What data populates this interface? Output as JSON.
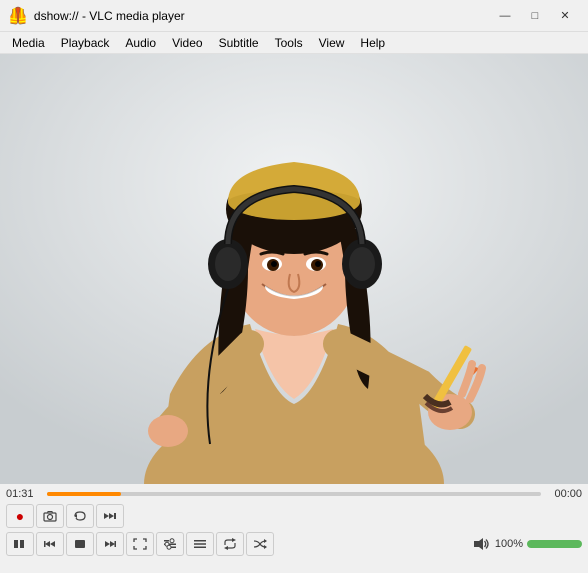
{
  "titleBar": {
    "title": "dshow:// - VLC media player",
    "iconColor": "#ff8800",
    "minBtn": "—",
    "maxBtn": "□",
    "closeBtn": "✕"
  },
  "menuBar": {
    "items": [
      "Media",
      "Playback",
      "Audio",
      "Video",
      "Subtitle",
      "Tools",
      "View",
      "Help"
    ]
  },
  "timeline": {
    "elapsed": "01:31",
    "remaining": "00:00",
    "progressPercent": 15
  },
  "controls": {
    "row1": [
      {
        "id": "record",
        "label": "●",
        "type": "red"
      },
      {
        "id": "snapshot",
        "label": "📷"
      },
      {
        "id": "loop",
        "label": "↻"
      },
      {
        "id": "play-next",
        "label": "▶|"
      }
    ],
    "row2": [
      {
        "id": "play-pause",
        "label": "⏸"
      },
      {
        "id": "prev",
        "label": "⏮"
      },
      {
        "id": "stop",
        "label": "■"
      },
      {
        "id": "next",
        "label": "⏭"
      },
      {
        "id": "fullscreen",
        "label": "⛶"
      },
      {
        "id": "extended",
        "label": "≡"
      },
      {
        "id": "playlist",
        "label": "☰"
      },
      {
        "id": "loop2",
        "label": "🔁"
      },
      {
        "id": "random",
        "label": "⤲"
      }
    ]
  },
  "volume": {
    "label": "100%",
    "percent": 100,
    "iconLabel": "🔊"
  }
}
